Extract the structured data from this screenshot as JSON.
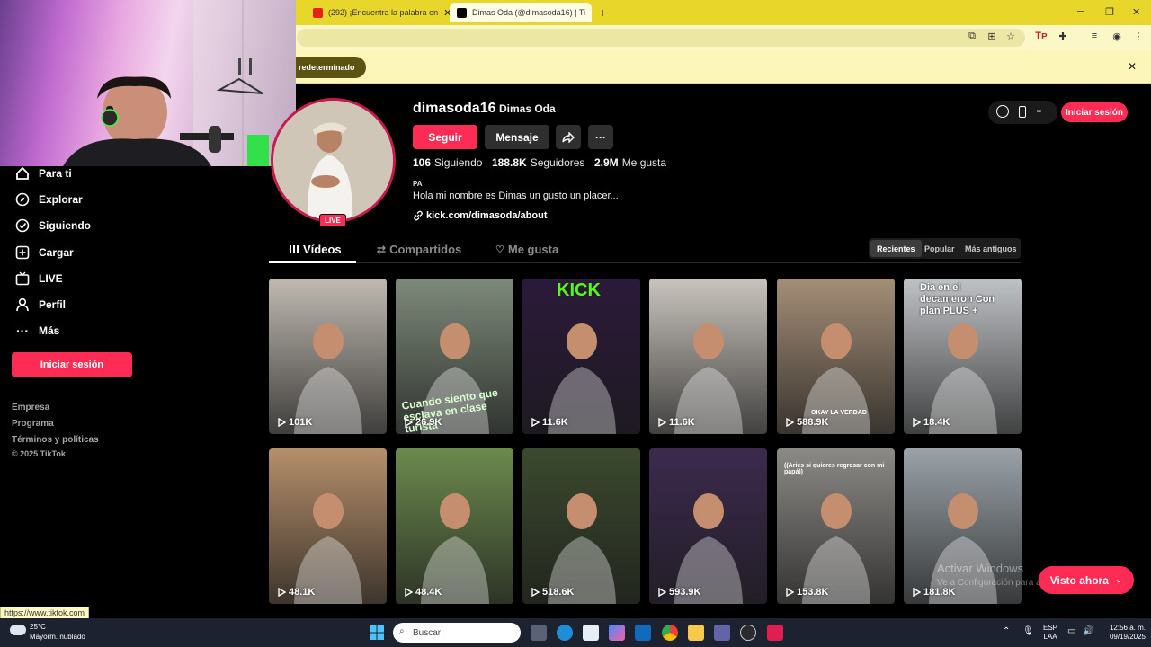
{
  "browser": {
    "tabs": [
      {
        "title": "(292) ¡Encuentra la palabra en"
      },
      {
        "title": "Dimas Oda (@dimasoda16) | Ti"
      }
    ],
    "new_tab": "+",
    "infobar_text": "redeterminado",
    "status_url": "https://www.tiktok.com"
  },
  "sidebar": {
    "items": [
      {
        "label": "Para ti",
        "icon": "home-icon"
      },
      {
        "label": "Explorar",
        "icon": "compass-icon"
      },
      {
        "label": "Siguiendo",
        "icon": "following-icon"
      },
      {
        "label": "Cargar",
        "icon": "upload-icon"
      },
      {
        "label": "LIVE",
        "icon": "live-icon"
      },
      {
        "label": "Perfil",
        "icon": "profile-icon"
      },
      {
        "label": "Más",
        "icon": "more-icon"
      }
    ],
    "login_label": "Iniciar sesión",
    "footer": [
      "Empresa",
      "Programa",
      "Términos y políticas",
      "© 2025 TikTok"
    ]
  },
  "profile": {
    "username": "dimasoda16",
    "nickname": "Dimas Oda",
    "follow_label": "Seguir",
    "message_label": "Mensaje",
    "live_badge": "LIVE",
    "following_count": "106",
    "following_label": "Siguiendo",
    "followers_count": "188.8K",
    "followers_label": "Seguidores",
    "likes_count": "2.9M",
    "likes_label": "Me gusta",
    "region": "PA",
    "bio": "Hola mi nombre es Dimas un gusto un placer...",
    "link": "kick.com/dimasoda/about"
  },
  "header": {
    "login_label": "Iniciar sesión"
  },
  "tabs": {
    "videos": "Vídeos",
    "reposts": "Compartidos",
    "liked": "Me gusta"
  },
  "sort": {
    "recent": "Recientes",
    "popular": "Popular",
    "oldest": "Más antiguos"
  },
  "videos": [
    {
      "views": "101K",
      "color": "#bfb9b0"
    },
    {
      "views": "26.9K",
      "color": "#7d8a7a",
      "overlay": "Cuando siento que esclava en clase turista"
    },
    {
      "views": "11.6K",
      "color": "#2b1a3a",
      "overlay": "KICK"
    },
    {
      "views": "11.6K",
      "color": "#c9c4bd"
    },
    {
      "views": "588.9K",
      "color": "#a48e77",
      "overlay": "OKAY LA VERDAD"
    },
    {
      "views": "18.4K",
      "color": "#bfc2c5",
      "overlay": "Dia en el decameron Con plan PLUS +"
    },
    {
      "views": "48.1K",
      "color": "#b58f6b"
    },
    {
      "views": "48.4K",
      "color": "#6c8a4e"
    },
    {
      "views": "518.6K",
      "color": "#3b4a2e"
    },
    {
      "views": "593.9K",
      "color": "#3c2a4e"
    },
    {
      "views": "153.8K",
      "color": "#8c8a86",
      "overlay": "((Aries si quieres regresar con mi papá))"
    },
    {
      "views": "181.8K",
      "color": "#9aa2a8"
    }
  ],
  "watch_now": "Visto ahora",
  "watermark": {
    "line1": "Activar Windows",
    "line2": "Ve a Configuración para activar Windows."
  },
  "taskbar": {
    "temp": "25°C",
    "weather": "Mayorm. nublado",
    "search_placeholder": "Buscar",
    "lang1": "ESP",
    "lang2": "LAA",
    "time": "12:56 a. m.",
    "date": "09/19/2025"
  },
  "colors": {
    "accent": "#fe2c55",
    "chrome_frame": "#e8d62a"
  }
}
